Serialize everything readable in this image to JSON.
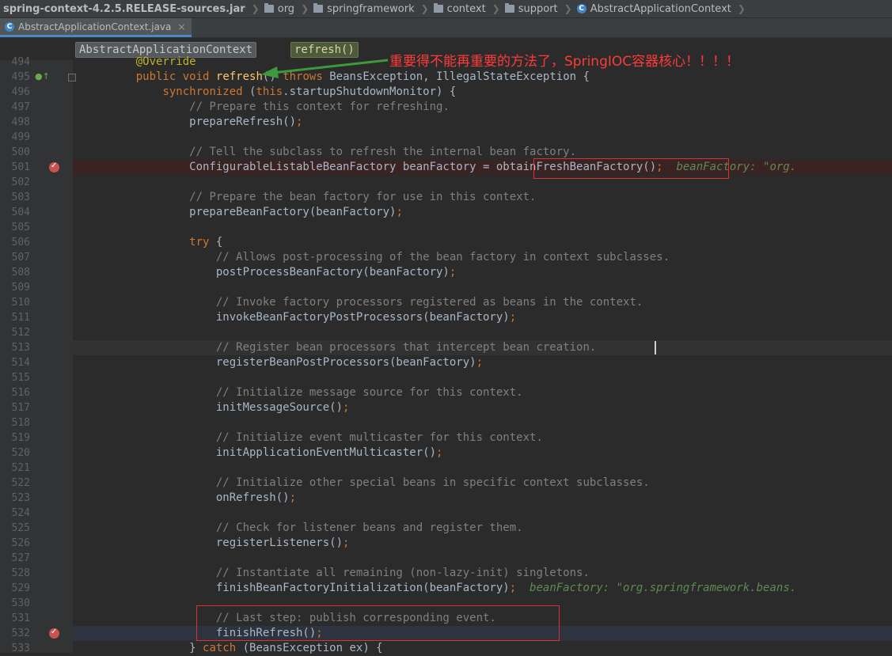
{
  "breadcrumb": {
    "items": [
      {
        "label": "spring-context-4.2.5.RELEASE-sources.jar",
        "icon": "jar"
      },
      {
        "label": "org",
        "icon": "folder-icon"
      },
      {
        "label": "springframework",
        "icon": "folder-icon"
      },
      {
        "label": "context",
        "icon": "folder-icon"
      },
      {
        "label": "support",
        "icon": "folder-icon"
      },
      {
        "label": "AbstractApplicationContext",
        "icon": "class-icon"
      }
    ]
  },
  "tab": {
    "label": "AbstractApplicationContext.java",
    "close": "×"
  },
  "nav": {
    "class_name": "AbstractApplicationContext",
    "method_name": "refresh()"
  },
  "annotation": "重要得不能再重要的方法了，SpringIOC容器核心！！！！",
  "code": {
    "lines": [
      {
        "n": "494",
        "text": "    @Override"
      },
      {
        "n": "495",
        "text": "    public void refresh() throws BeansException, IllegalStateException {"
      },
      {
        "n": "496",
        "text": "        synchronized (this.startupShutdownMonitor) {"
      },
      {
        "n": "497",
        "text": "            // Prepare this context for refreshing."
      },
      {
        "n": "498",
        "text": "            prepareRefresh();"
      },
      {
        "n": "499",
        "text": ""
      },
      {
        "n": "500",
        "text": "            // Tell the subclass to refresh the internal bean factory."
      },
      {
        "n": "501",
        "text": "            ConfigurableListableBeanFactory beanFactory = obtainFreshBeanFactory();  beanFactory: \"org."
      },
      {
        "n": "502",
        "text": ""
      },
      {
        "n": "503",
        "text": "            // Prepare the bean factory for use in this context."
      },
      {
        "n": "504",
        "text": "            prepareBeanFactory(beanFactory);"
      },
      {
        "n": "505",
        "text": ""
      },
      {
        "n": "506",
        "text": "            try {"
      },
      {
        "n": "507",
        "text": "                // Allows post-processing of the bean factory in context subclasses."
      },
      {
        "n": "508",
        "text": "                postProcessBeanFactory(beanFactory);"
      },
      {
        "n": "509",
        "text": ""
      },
      {
        "n": "510",
        "text": "                // Invoke factory processors registered as beans in the context."
      },
      {
        "n": "511",
        "text": "                invokeBeanFactoryPostProcessors(beanFactory);"
      },
      {
        "n": "512",
        "text": ""
      },
      {
        "n": "513",
        "text": "                // Register bean processors that intercept bean creation."
      },
      {
        "n": "514",
        "text": "                registerBeanPostProcessors(beanFactory);"
      },
      {
        "n": "515",
        "text": ""
      },
      {
        "n": "516",
        "text": "                // Initialize message source for this context."
      },
      {
        "n": "517",
        "text": "                initMessageSource();"
      },
      {
        "n": "518",
        "text": ""
      },
      {
        "n": "519",
        "text": "                // Initialize event multicaster for this context."
      },
      {
        "n": "520",
        "text": "                initApplicationEventMulticaster();"
      },
      {
        "n": "521",
        "text": ""
      },
      {
        "n": "522",
        "text": "                // Initialize other special beans in specific context subclasses."
      },
      {
        "n": "523",
        "text": "                onRefresh();"
      },
      {
        "n": "524",
        "text": ""
      },
      {
        "n": "525",
        "text": "                // Check for listener beans and register them."
      },
      {
        "n": "526",
        "text": "                registerListeners();"
      },
      {
        "n": "527",
        "text": ""
      },
      {
        "n": "528",
        "text": "                // Instantiate all remaining (non-lazy-init) singletons."
      },
      {
        "n": "529",
        "text": "                finishBeanFactoryInitialization(beanFactory);  beanFactory: \"org.springframework.beans."
      },
      {
        "n": "530",
        "text": ""
      },
      {
        "n": "531",
        "text": "                // Last step: publish corresponding event."
      },
      {
        "n": "532",
        "text": "                finishRefresh();"
      },
      {
        "n": "533",
        "text": "            } catch (BeansException ex) {"
      }
    ]
  },
  "colors": {
    "keyword": "#cc7832",
    "method_decl": "#ffc66d",
    "comment": "#808080",
    "annotation": "#bbb529",
    "debug_hint": "#5f8a52",
    "text": "#a9b7c6",
    "highlight_box": "#e0302e",
    "arrow": "#3c9a3c",
    "breakpoint": "#c75450"
  }
}
